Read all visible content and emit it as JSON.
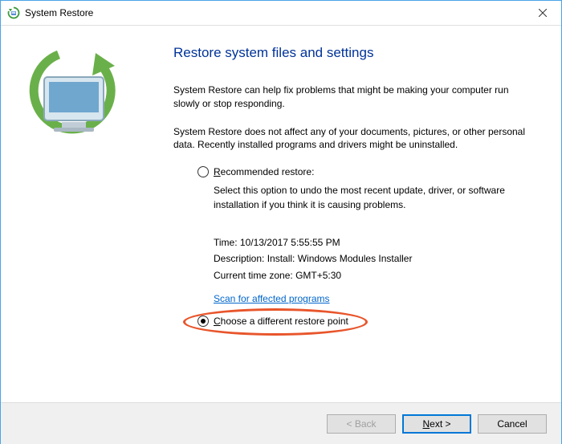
{
  "window": {
    "title": "System Restore"
  },
  "heading": "Restore system files and settings",
  "para1": "System Restore can help fix problems that might be making your computer run slowly or stop responding.",
  "para2": "System Restore does not affect any of your documents, pictures, or other personal data. Recently installed programs and drivers might be uninstalled.",
  "options": {
    "recommended": {
      "label_pre": "R",
      "label_rest": "ecommended restore:",
      "desc": "Select this option to undo the most recent update, driver, or software installation if you think it is causing problems.",
      "time_label": "Time:",
      "time_value": "10/13/2017 5:55:55 PM",
      "desc_label": "Description:",
      "desc_value": "Install: Windows Modules Installer",
      "tz_label": "Current time zone:",
      "tz_value": "GMT+5:30",
      "scan_link": "Scan for affected programs"
    },
    "choose": {
      "label_pre": "C",
      "label_rest": "hoose a different restore point"
    }
  },
  "buttons": {
    "back": "< Back",
    "next_pre": "N",
    "next_rest": "ext >",
    "cancel": "Cancel"
  }
}
